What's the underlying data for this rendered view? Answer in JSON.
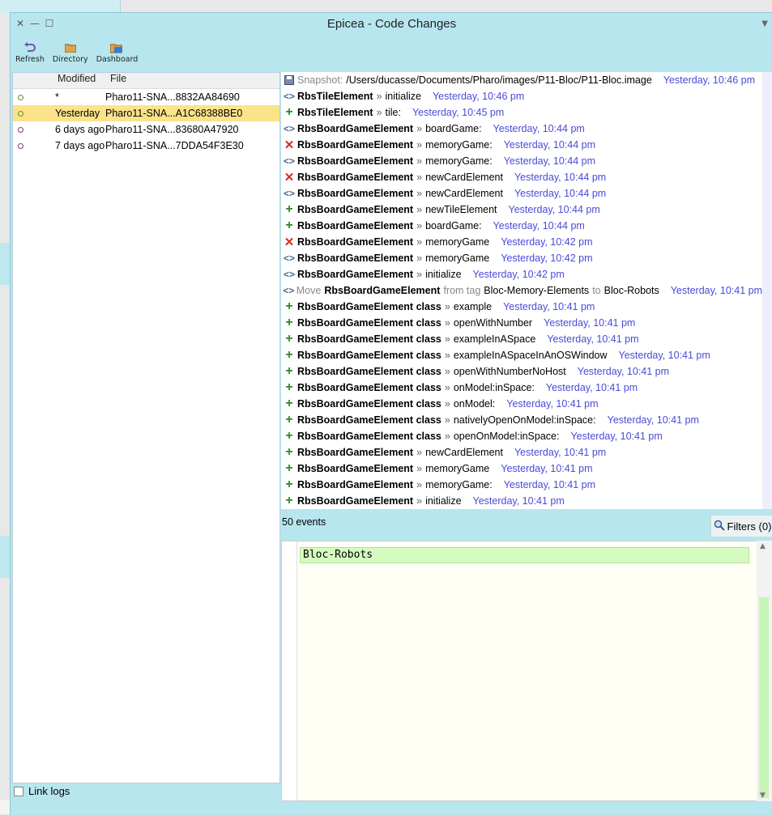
{
  "window": {
    "title": "Epicea - Code Changes",
    "toolbar": [
      {
        "label": "Refresh",
        "icon": "refresh-icon"
      },
      {
        "label": "Directory",
        "icon": "folder-icon"
      },
      {
        "label": "Dashboard",
        "icon": "dashboard-icon"
      }
    ]
  },
  "logs": {
    "headers": {
      "modified": "Modified",
      "file": "File"
    },
    "rows": [
      {
        "modified": "*",
        "file": "Pharo11-SNA...8832AA84690"
      },
      {
        "modified": "Yesterday",
        "file": "Pharo11-SNA...A1C68388BE0"
      },
      {
        "modified": "6 days ago",
        "file": "Pharo11-SNA...83680A47920"
      },
      {
        "modified": "7 days ago",
        "file": "Pharo11-SNA...7DDA54F3E30"
      }
    ],
    "link_logs_label": "Link logs"
  },
  "events": {
    "snapshot": {
      "label": "Snapshot:",
      "path": "/Users/ducasse/Documents/Pharo/images/P11-Bloc/P11-Bloc.image",
      "time": "Yesterday, 10:46 pm"
    },
    "rows": [
      {
        "type": "mod",
        "cls": "RbsTileElement",
        "sel": "initialize",
        "time": "Yesterday, 10:46 pm"
      },
      {
        "type": "add",
        "cls": "RbsTileElement",
        "sel": "tile:",
        "time": "Yesterday, 10:45 pm"
      },
      {
        "type": "mod",
        "cls": "RbsBoardGameElement",
        "sel": "boardGame:",
        "time": "Yesterday, 10:44 pm"
      },
      {
        "type": "del",
        "cls": "RbsBoardGameElement",
        "sel": "memoryGame:",
        "time": "Yesterday, 10:44 pm"
      },
      {
        "type": "mod",
        "cls": "RbsBoardGameElement",
        "sel": "memoryGame:",
        "time": "Yesterday, 10:44 pm"
      },
      {
        "type": "del",
        "cls": "RbsBoardGameElement",
        "sel": "newCardElement",
        "time": "Yesterday, 10:44 pm"
      },
      {
        "type": "mod",
        "cls": "RbsBoardGameElement",
        "sel": "newCardElement",
        "time": "Yesterday, 10:44 pm"
      },
      {
        "type": "add",
        "cls": "RbsBoardGameElement",
        "sel": "newTileElement",
        "time": "Yesterday, 10:44 pm"
      },
      {
        "type": "add",
        "cls": "RbsBoardGameElement",
        "sel": "boardGame:",
        "time": "Yesterday, 10:44 pm"
      },
      {
        "type": "del",
        "cls": "RbsBoardGameElement",
        "sel": "memoryGame",
        "time": "Yesterday, 10:42 pm"
      },
      {
        "type": "mod",
        "cls": "RbsBoardGameElement",
        "sel": "memoryGame",
        "time": "Yesterday, 10:42 pm"
      },
      {
        "type": "mod",
        "cls": "RbsBoardGameElement",
        "sel": "initialize",
        "time": "Yesterday, 10:42 pm"
      }
    ],
    "move": {
      "word_move": "Move",
      "cls": "RbsBoardGameElement",
      "word_from": "from tag",
      "from": "Bloc-Memory-Elements",
      "word_to": "to",
      "to": "Bloc-Robots",
      "time": "Yesterday, 10:41 pm"
    },
    "rows2": [
      {
        "cls": "RbsBoardGameElement class",
        "sel": "example",
        "time": "Yesterday, 10:41 pm"
      },
      {
        "cls": "RbsBoardGameElement class",
        "sel": "openWithNumber",
        "time": "Yesterday, 10:41 pm"
      },
      {
        "cls": "RbsBoardGameElement class",
        "sel": "exampleInASpace",
        "time": "Yesterday, 10:41 pm"
      },
      {
        "cls": "RbsBoardGameElement class",
        "sel": "exampleInASpaceInAnOSWindow",
        "time": "Yesterday, 10:41 pm"
      },
      {
        "cls": "RbsBoardGameElement class",
        "sel": "openWithNumberNoHost",
        "time": "Yesterday, 10:41 pm"
      },
      {
        "cls": "RbsBoardGameElement class",
        "sel": "onModel:inSpace:",
        "time": "Yesterday, 10:41 pm"
      },
      {
        "cls": "RbsBoardGameElement class",
        "sel": "onModel:",
        "time": "Yesterday, 10:41 pm"
      },
      {
        "cls": "RbsBoardGameElement class",
        "sel": "nativelyOpenOnModel:inSpace:",
        "time": "Yesterday, 10:41 pm"
      },
      {
        "cls": "RbsBoardGameElement class",
        "sel": "openOnModel:inSpace:",
        "time": "Yesterday, 10:41 pm"
      },
      {
        "cls": "RbsBoardGameElement",
        "sel": "newCardElement",
        "time": "Yesterday, 10:41 pm"
      },
      {
        "cls": "RbsBoardGameElement",
        "sel": "memoryGame",
        "time": "Yesterday, 10:41 pm"
      },
      {
        "cls": "RbsBoardGameElement",
        "sel": "memoryGame:",
        "time": "Yesterday, 10:41 pm"
      },
      {
        "cls": "RbsBoardGameElement",
        "sel": "initialize",
        "time": "Yesterday, 10:41 pm"
      }
    ],
    "separator": "»",
    "count": "50 events",
    "filters": "Filters (0)"
  },
  "code": {
    "text": "Bloc-Robots"
  }
}
